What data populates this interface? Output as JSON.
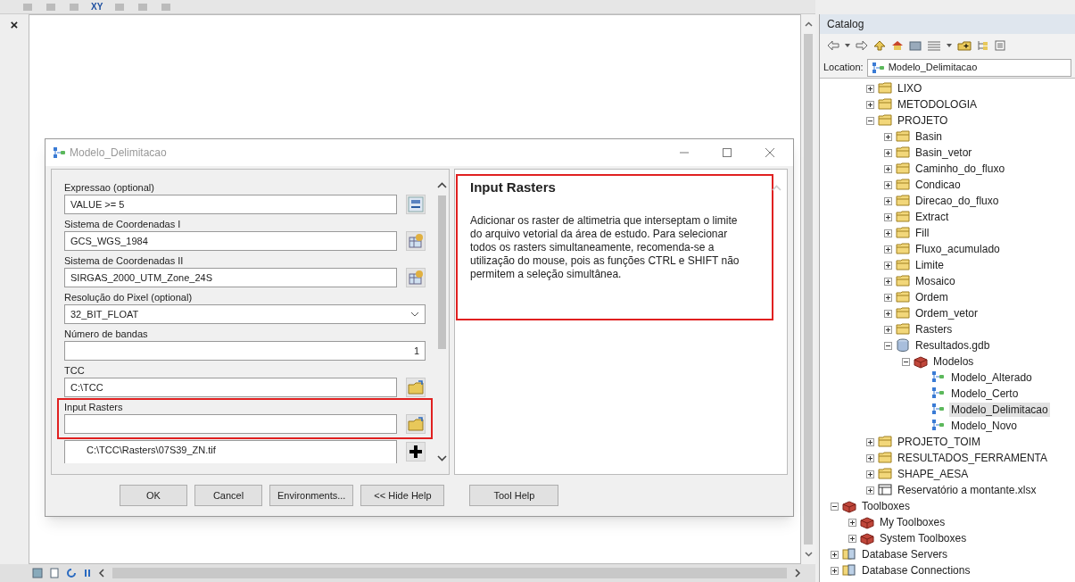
{
  "toolbar": {
    "label": "XY"
  },
  "map": {
    "close": "×"
  },
  "dialog": {
    "title": "Modelo_Delimitacao",
    "parameters": [
      {
        "label": "Expressao (optional)",
        "kind": "text",
        "value": "VALUE >= 5",
        "button": {
          "kind": "sql"
        },
        "highlighted": false
      },
      {
        "label": "Sistema de Coordenadas I",
        "kind": "text",
        "value": "GCS_WGS_1984",
        "button": {
          "kind": "coord"
        },
        "highlighted": false
      },
      {
        "label": "Sistema de Coordenadas II",
        "kind": "text",
        "value": "SIRGAS_2000_UTM_Zone_24S",
        "button": {
          "kind": "coord"
        },
        "highlighted": false
      },
      {
        "label": "Resolução do Pixel (optional)",
        "kind": "dropdown",
        "value": "32_BIT_FLOAT",
        "highlighted": false
      },
      {
        "label": "Número de bandas",
        "kind": "number",
        "value": "1",
        "highlighted": false
      },
      {
        "label": "TCC",
        "kind": "text",
        "value": "C:\\TCC",
        "button": {
          "kind": "folder"
        },
        "highlighted": false
      },
      {
        "label": "Input Rasters",
        "kind": "text",
        "button": {
          "kind": "folder"
        },
        "highlighted": true
      },
      {
        "kind": "list",
        "entries": [
          "C:\\TCC\\Rasters\\07S39_ZN.tif"
        ],
        "button": {
          "kind": "add"
        },
        "highlighted": false
      }
    ],
    "help": {
      "title": "Input Rasters",
      "text": "Adicionar os raster de altimetria que interseptam o limite do arquivo vetorial da área de estudo. Para selecionar todos os rasters simultaneamente, recomenda-se a utilização do mouse, pois as funções CTRL e SHIFT não permitem a seleção simultânea.",
      "highlighted": true
    },
    "buttons": [
      "OK",
      "Cancel",
      "Environments...",
      "<< Hide Help",
      "Tool Help"
    ]
  },
  "catalog": {
    "title": "Catalog",
    "location_label": "Location:",
    "location": "Modelo_Delimitacao",
    "tree": {
      "continued_items": [
        {
          "label": "LIXO",
          "kind": "folder",
          "expanded": false,
          "selected": false
        },
        {
          "label": "METODOLOGIA",
          "kind": "folder",
          "expanded": false,
          "selected": false
        },
        {
          "label": "PROJETO",
          "kind": "folder",
          "expanded": true,
          "selected": false,
          "children": [
            {
              "label": "Basin",
              "kind": "folder",
              "expanded": false,
              "selected": false
            },
            {
              "label": "Basin_vetor",
              "kind": "folder",
              "expanded": false,
              "selected": false
            },
            {
              "label": "Caminho_do_fluxo",
              "kind": "folder",
              "expanded": false,
              "selected": false
            },
            {
              "label": "Condicao",
              "kind": "folder",
              "expanded": false,
              "selected": false
            },
            {
              "label": "Direcao_do_fluxo",
              "kind": "folder",
              "expanded": false,
              "selected": false
            },
            {
              "label": "Extract",
              "kind": "folder",
              "expanded": false,
              "selected": false
            },
            {
              "label": "Fill",
              "kind": "folder",
              "expanded": false,
              "selected": false
            },
            {
              "label": "Fluxo_acumulado",
              "kind": "folder",
              "expanded": false,
              "selected": false
            },
            {
              "label": "Limite",
              "kind": "folder",
              "expanded": false,
              "selected": false
            },
            {
              "label": "Mosaico",
              "kind": "folder",
              "expanded": false,
              "selected": false
            },
            {
              "label": "Ordem",
              "kind": "folder",
              "expanded": false,
              "selected": false
            },
            {
              "label": "Ordem_vetor",
              "kind": "folder",
              "expanded": false,
              "selected": false
            },
            {
              "label": "Rasters",
              "kind": "folder",
              "expanded": false,
              "selected": false
            },
            {
              "label": "Resultados.gdb",
              "kind": "gdb",
              "expanded": true,
              "selected": false,
              "children": [
                {
                  "label": "Modelos",
                  "kind": "toolbox",
                  "expanded": true,
                  "selected": false,
                  "children": [
                    {
                      "label": "Modelo_Alterado",
                      "kind": "model",
                      "selected": false
                    },
                    {
                      "label": "Modelo_Certo",
                      "kind": "model",
                      "selected": false
                    },
                    {
                      "label": "Modelo_Delimitacao",
                      "kind": "model",
                      "selected": true
                    },
                    {
                      "label": "Modelo_Novo",
                      "kind": "model",
                      "selected": false
                    }
                  ]
                }
              ]
            }
          ]
        },
        {
          "label": "PROJETO_TOIM",
          "kind": "folder",
          "expanded": false,
          "selected": false
        },
        {
          "label": "RESULTADOS_FERRAMENTA",
          "kind": "folder",
          "expanded": false,
          "selected": false
        },
        {
          "label": "SHAPE_AESA",
          "kind": "folder",
          "expanded": false,
          "selected": false
        },
        {
          "label": "Reservatório a montante.xlsx",
          "kind": "table",
          "expanded": false,
          "selected": false
        }
      ],
      "items": [
        {
          "label": "Toolboxes",
          "kind": "toolbox",
          "expanded": true,
          "selected": false,
          "children": [
            {
              "label": "My Toolboxes",
              "kind": "toolbox",
              "expanded": false,
              "selected": false
            },
            {
              "label": "System Toolboxes",
              "kind": "toolbox",
              "expanded": false,
              "selected": false
            }
          ]
        },
        {
          "label": "Database Servers",
          "kind": "server",
          "expanded": false,
          "selected": false
        },
        {
          "label": "Database Connections",
          "kind": "server",
          "expanded": false,
          "selected": false
        }
      ]
    }
  }
}
